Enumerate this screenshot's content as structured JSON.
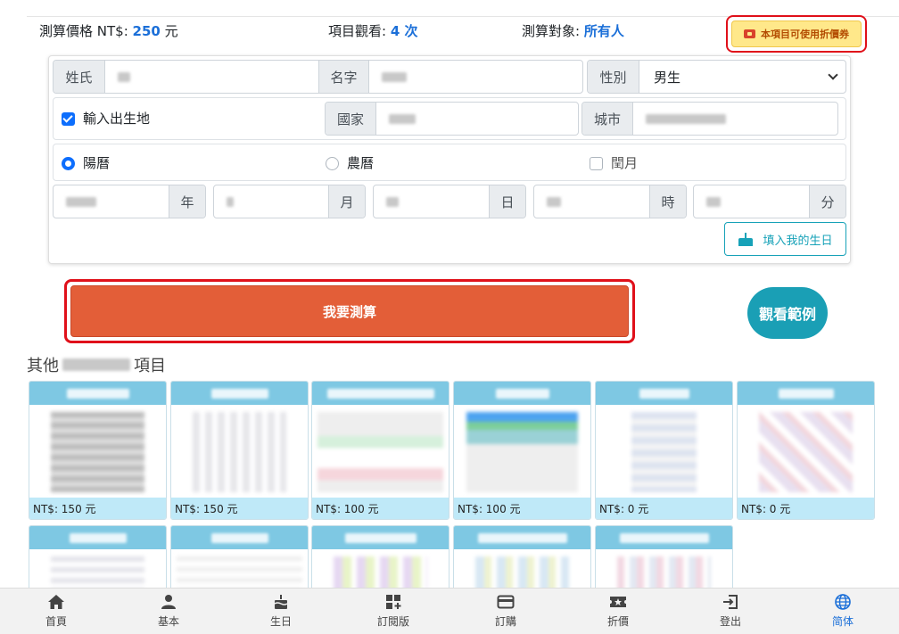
{
  "header": {
    "price_label": "測算價格 NT$:",
    "price_value": "250",
    "price_unit": "元",
    "views_label": "項目觀看:",
    "views_value": "4 次",
    "target_label": "測算對象:",
    "target_value": "所有人",
    "coupon_label": "本項目可使用折價券"
  },
  "form": {
    "surname_label": "姓氏",
    "name_label": "名字",
    "gender_label": "性別",
    "gender_value": "男生",
    "birthplace_checkbox_label": "輸入出生地",
    "country_label": "國家",
    "city_label": "城市",
    "calendar_solar": "陽曆",
    "calendar_lunar": "農曆",
    "leap_month": "閏月",
    "year_label": "年",
    "month_label": "月",
    "day_label": "日",
    "hour_label": "時",
    "minute_label": "分",
    "fill_birthday_button": "填入我的生日"
  },
  "actions": {
    "calculate_button": "我要測算",
    "sample_button": "觀看範例"
  },
  "other": {
    "title_prefix": "其他",
    "title_suffix": "項目",
    "items": [
      {
        "price": "NT$: 150 元"
      },
      {
        "price": "NT$: 150 元"
      },
      {
        "price": "NT$: 100 元"
      },
      {
        "price": "NT$: 100 元"
      },
      {
        "price": "NT$: 0 元"
      },
      {
        "price": "NT$: 0 元"
      }
    ]
  },
  "nav": [
    {
      "label": "首頁",
      "icon": "home-icon"
    },
    {
      "label": "基本",
      "icon": "user-icon"
    },
    {
      "label": "生日",
      "icon": "cake-icon"
    },
    {
      "label": "訂閱版",
      "icon": "grid-plus-icon"
    },
    {
      "label": "訂購",
      "icon": "credit-card-icon"
    },
    {
      "label": "折價",
      "icon": "ticket-icon"
    },
    {
      "label": "登出",
      "icon": "logout-icon"
    },
    {
      "label": "简体",
      "icon": "globe-icon"
    }
  ],
  "colors": {
    "accent": "#1b6fd8",
    "calc_button": "#e35e38",
    "sample_button": "#1a9fb5",
    "highlight_border": "#e0101a",
    "tile_header": "#7ec8e3"
  }
}
